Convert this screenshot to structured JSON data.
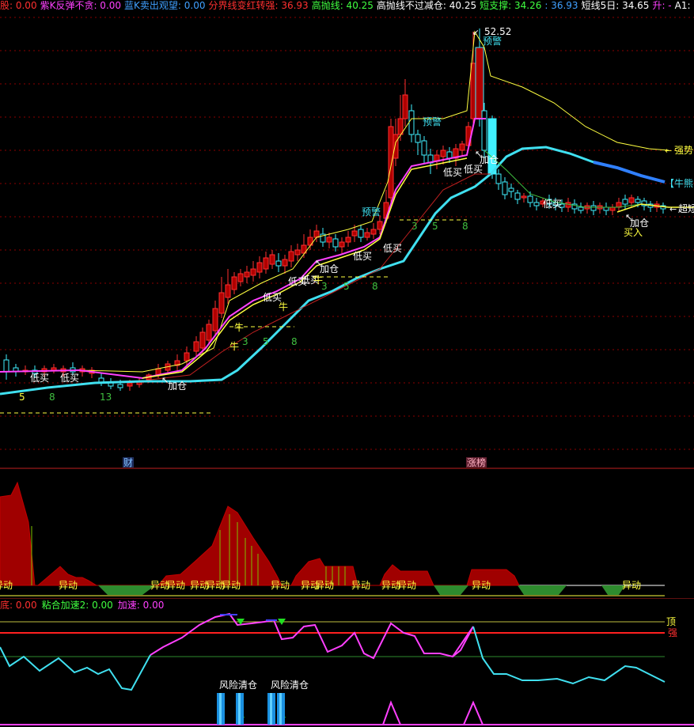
{
  "colors": {
    "red": "#ff3030",
    "yellow": "#ffff40",
    "cyan": "#40e0f0",
    "magenta": "#ff40ff",
    "green": "#40c040",
    "white": "#ffffff",
    "blue": "#3080ff",
    "candle_red": "#b00000",
    "candle_cyan": "#40f0ff",
    "olive": "#2e8b2e"
  },
  "top_indicators": [
    {
      "label": "股: 0.00",
      "color": "#ff3030"
    },
    {
      "label": "紫K反弹不贪: 0.00",
      "color": "#ff40ff"
    },
    {
      "label": "蓝K卖出观望: 0.00",
      "color": "#40a0ff"
    },
    {
      "label": "分界线变红转强: 36.93",
      "color": "#ff3030"
    },
    {
      "label": "高抛线: 40.25",
      "color": "#40ff40"
    },
    {
      "label": "高抛线不过减仓: 40.25",
      "color": "#ffffff"
    },
    {
      "label": "短支撑: 34.26",
      "color": "#40ff40"
    },
    {
      "label": ": 36.93",
      "color": "#40a0ff"
    },
    {
      "label": "短线5日: 34.65",
      "color": "#ffffff"
    },
    {
      "label": "升: -",
      "color": "#ff40ff"
    },
    {
      "label": "A1: 34.",
      "color": "#ffffff"
    }
  ],
  "main_chart": {
    "peak_label": "52.52",
    "right_labels": {
      "strong": "强势",
      "bull": "【牛熊",
      "super": "超短"
    },
    "annotations": [
      {
        "text": "预警",
        "color": "#40e0f0"
      },
      {
        "text": "预警",
        "color": "#40e0f0"
      },
      {
        "text": "预警",
        "color": "#40e0f0"
      },
      {
        "text": "加仓",
        "color": "#ffffff"
      },
      {
        "text": "加仓",
        "color": "#ffffff"
      },
      {
        "text": "加仓",
        "color": "#ffffff"
      },
      {
        "text": "加仓",
        "color": "#ffffff"
      },
      {
        "text": "低买",
        "color": "#ffffff"
      },
      {
        "text": "低买",
        "color": "#ffffff"
      },
      {
        "text": "低买",
        "color": "#ffffff"
      },
      {
        "text": "低买",
        "color": "#ffffff"
      },
      {
        "text": "低买",
        "color": "#ffffff"
      },
      {
        "text": "低买",
        "color": "#ffffff"
      },
      {
        "text": "低买",
        "color": "#ffffff"
      },
      {
        "text": "低买",
        "color": "#ffffff"
      },
      {
        "text": "低买",
        "color": "#ffffff"
      },
      {
        "text": "低买",
        "color": "#ffffff"
      },
      {
        "text": "牛",
        "color": "#ffff40"
      },
      {
        "text": "牛",
        "color": "#ffff40"
      },
      {
        "text": "牛",
        "color": "#ffff40"
      },
      {
        "text": "牛",
        "color": "#ffff40"
      },
      {
        "text": "买入",
        "color": "#ffff40"
      }
    ],
    "fib_numbers": [
      "5",
      "8",
      "13",
      "3",
      "5",
      "8",
      "3",
      "5",
      "8",
      "3",
      "5",
      "8"
    ],
    "bottom_tags": {
      "cai": "财",
      "zhangbang": "涨榜"
    }
  },
  "sub1": {
    "yidong_label": "异动"
  },
  "sub2": {
    "header": [
      {
        "label": "底: 0.00",
        "color": "#ff3030"
      },
      {
        "label": "粘合加速2: 0.00",
        "color": "#40ff40"
      },
      {
        "label": "加速: 0.00",
        "color": "#ff40ff"
      }
    ],
    "right_labels": {
      "top": "顶",
      "strong": "强"
    },
    "risk_labels": [
      "风险清仓",
      "风险清仓"
    ]
  }
}
